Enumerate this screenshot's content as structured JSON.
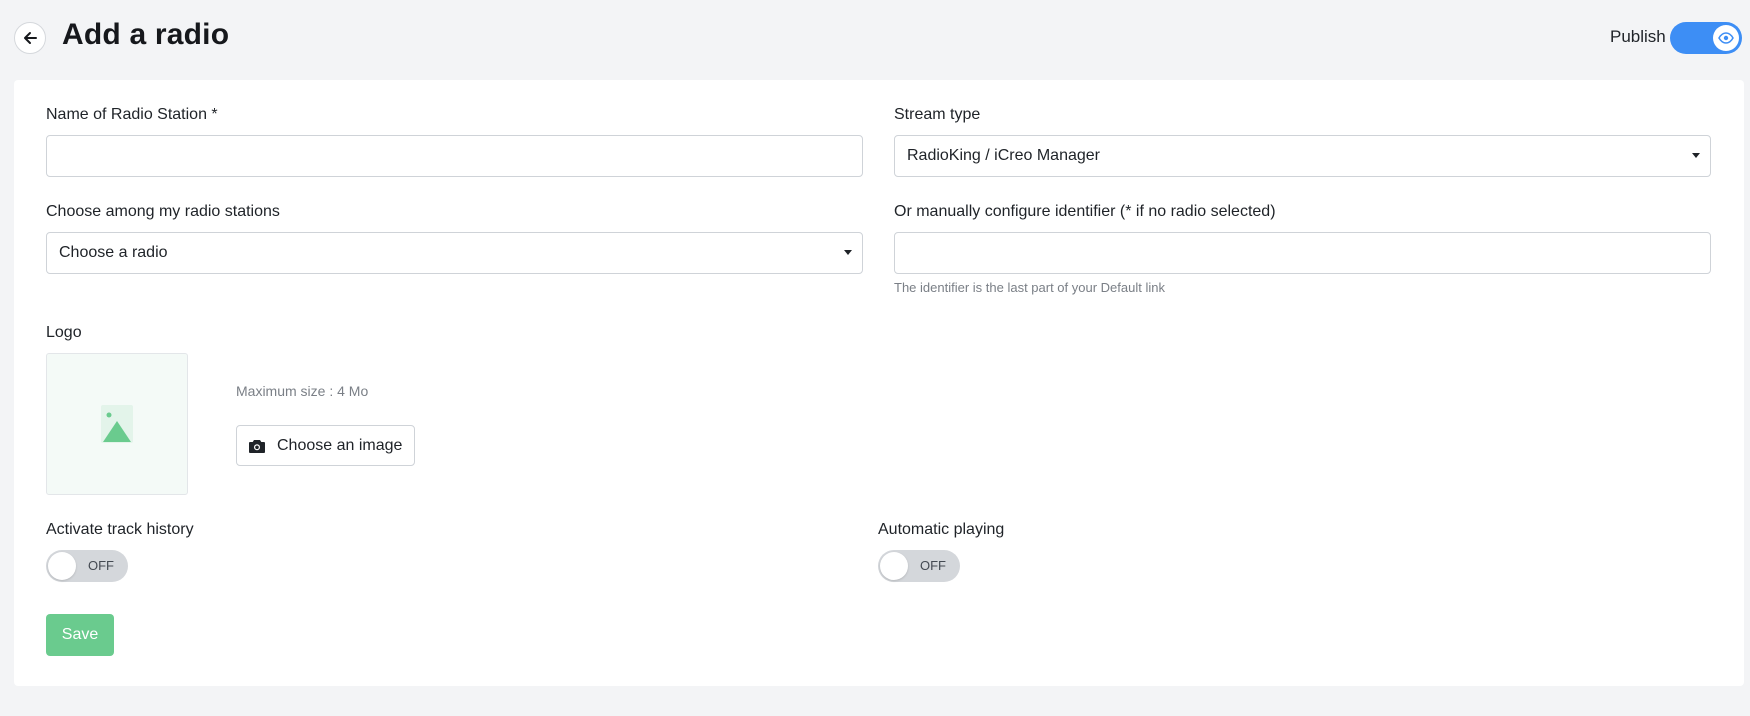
{
  "header": {
    "title": "Add a radio",
    "publish_label": "Publish",
    "publish_on": true
  },
  "form": {
    "station_name": {
      "label": "Name of Radio Station *",
      "value": ""
    },
    "stream_type": {
      "label": "Stream type",
      "selected": "RadioKing / iCreo Manager"
    },
    "my_stations": {
      "label": "Choose among my radio stations",
      "selected": "Choose a radio"
    },
    "identifier": {
      "label": "Or manually configure identifier (* if no radio selected)",
      "value": "",
      "hint": "The identifier is the last part of your Default link"
    },
    "logo": {
      "label": "Logo",
      "max_size": "Maximum size : 4 Mo",
      "button_label": "Choose an image"
    },
    "track_history": {
      "label": "Activate track history",
      "state": "OFF"
    },
    "auto_play": {
      "label": "Automatic playing",
      "state": "OFF"
    },
    "save_label": "Save"
  },
  "colors": {
    "accent_blue": "#3d8ef5",
    "save_green": "#6acb8e",
    "placeholder_green": "#6acb8e"
  },
  "icons": [
    "arrow-left-icon",
    "eye-icon",
    "image-placeholder-icon",
    "camera-icon",
    "chevron-down-icon"
  ]
}
